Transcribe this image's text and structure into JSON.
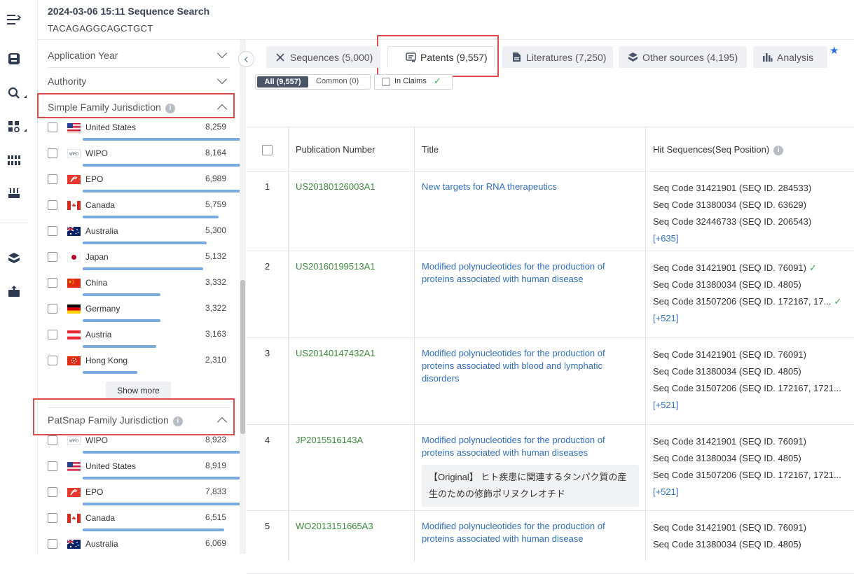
{
  "header": {
    "title": "2024-03-06 15:11 Sequence Search",
    "sequence": "TACAGAGGCAGCTGCT"
  },
  "rail": {
    "icons": [
      "menu-expand-icon",
      "save-icon",
      "search-icon",
      "grid-search-icon",
      "barcode-icon",
      "tray-icon",
      "box-icon",
      "export-icon"
    ]
  },
  "filters": {
    "collapsed": [
      {
        "label": "Application Year"
      },
      {
        "label": "Authority"
      }
    ],
    "simple_family": {
      "label": "Simple Family Jurisdiction",
      "items": [
        {
          "name": "United States",
          "count": "8,259",
          "ratio": 1.0
        },
        {
          "name": "WIPO",
          "count": "8,164",
          "ratio": 0.99
        },
        {
          "name": "EPO",
          "count": "6,989",
          "ratio": 0.85
        },
        {
          "name": "Canada",
          "count": "5,759",
          "ratio": 0.7
        },
        {
          "name": "Australia",
          "count": "5,300",
          "ratio": 0.64
        },
        {
          "name": "Japan",
          "count": "5,132",
          "ratio": 0.62
        },
        {
          "name": "China",
          "count": "3,332",
          "ratio": 0.4
        },
        {
          "name": "Germany",
          "count": "3,322",
          "ratio": 0.4
        },
        {
          "name": "Austria",
          "count": "3,163",
          "ratio": 0.38
        },
        {
          "name": "Hong Kong",
          "count": "2,310",
          "ratio": 0.28
        }
      ],
      "show_more": "Show more"
    },
    "patsnap_family": {
      "label": "PatSnap Family Jurisdiction",
      "items": [
        {
          "name": "WIPO",
          "count": "8,923",
          "ratio": 1.0
        },
        {
          "name": "United States",
          "count": "8,919",
          "ratio": 1.0
        },
        {
          "name": "EPO",
          "count": "7,833",
          "ratio": 0.88
        },
        {
          "name": "Canada",
          "count": "6,515",
          "ratio": 0.73
        },
        {
          "name": "Australia",
          "count": "6,069",
          "ratio": 0.68
        }
      ]
    }
  },
  "tabs": [
    {
      "label": "Sequences (5,000)",
      "icon": "dna-icon"
    },
    {
      "label": "Patents (9,557)",
      "icon": "patent-icon"
    },
    {
      "label": "Literatures (7,250)",
      "icon": "document-icon"
    },
    {
      "label": "Other sources (4,195)",
      "icon": "layers-icon"
    },
    {
      "label": "Analysis",
      "icon": "bar-chart-icon"
    }
  ],
  "subfilter": {
    "all": "All (9,557)",
    "common": "Common (0)",
    "in_claims": "In Claims"
  },
  "table": {
    "columns": [
      "Publication Number",
      "Title",
      "Hit Sequences(Seq Position)"
    ],
    "rows": [
      {
        "no": "1",
        "pub": "US20180126003A1",
        "title": "New targets for RNA therapeutics",
        "hits": [
          "Seq Code 31421901 (SEQ ID. 284533)",
          "Seq Code 31380034 (SEQ ID. 63629)",
          "Seq Code 32446733 (SEQ ID. 206543)"
        ],
        "more": "[+635]"
      },
      {
        "no": "2",
        "pub": "US20160199513A1",
        "title": "Modified polynucleotides for the production of proteins associated with human disease",
        "hits": [
          "Seq Code 31421901 (SEQ ID. 76091)",
          "Seq Code 31380034 (SEQ ID. 4805)",
          "Seq Code 31507206 (SEQ ID. 172167, 17..."
        ],
        "more": "[+521]"
      },
      {
        "no": "3",
        "pub": "US20140147432A1",
        "title": "Modified polynucleotides for the production of proteins associated with blood and lymphatic disorders",
        "hits": [
          "Seq Code 31421901 (SEQ ID. 76091)",
          "Seq Code 31380034 (SEQ ID. 4805)",
          "Seq Code 31507206 (SEQ ID. 172167, 1721..."
        ],
        "more": "[+521]"
      },
      {
        "no": "4",
        "pub": "JP2015516143A",
        "title": "Modified polynucleotides for the production of proteins associated with human diseases",
        "original": "【Original】 ヒト疾患に関連するタンパク質の産生のための修飾ポリヌクレオチド",
        "hits": [
          "Seq Code 31421901 (SEQ ID. 76091)",
          "Seq Code 31380034 (SEQ ID. 4805)",
          "Seq Code 31507206 (SEQ ID. 172167, 1721..."
        ],
        "more": "[+521]"
      },
      {
        "no": "5",
        "pub": "WO2013151665A3",
        "title": "Modified polynucleotides for the production of proteins associated with human disease",
        "hits": [
          "Seq Code 31421901 (SEQ ID. 76091)",
          "Seq Code 31380034 (SEQ ID. 4805)"
        ],
        "more": ""
      }
    ]
  }
}
